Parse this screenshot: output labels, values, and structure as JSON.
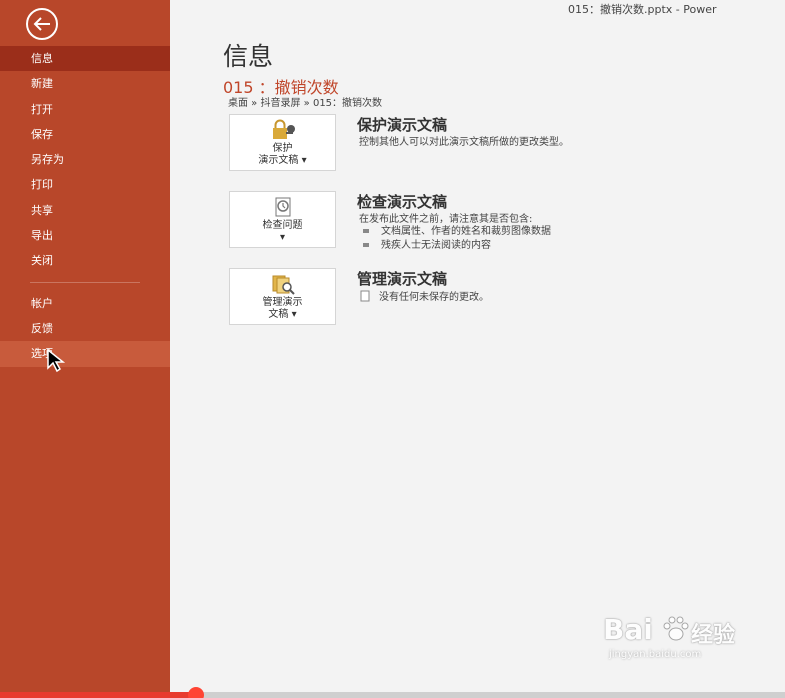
{
  "window": {
    "title": "015：撤销次数.pptx  -  Power"
  },
  "sidebar": {
    "back_icon": "back-arrow-icon",
    "items": [
      {
        "label": "信息"
      },
      {
        "label": "新建"
      },
      {
        "label": "打开"
      },
      {
        "label": "保存"
      },
      {
        "label": "另存为"
      },
      {
        "label": "打印"
      },
      {
        "label": "共享"
      },
      {
        "label": "导出"
      },
      {
        "label": "关闭"
      }
    ],
    "bottom_items": [
      {
        "label": "帐户"
      },
      {
        "label": "反馈"
      },
      {
        "label": "选项"
      }
    ],
    "active_index": 0,
    "hover_label": "选项",
    "colors": {
      "background": "#b8472a",
      "active": "#9b2e1a",
      "hover": "#c85b3c"
    }
  },
  "main": {
    "heading": "信息",
    "file_title": "015 ：撤销次数",
    "breadcrumb": "桌面 » 抖音录屏 » 015：撤销次数",
    "accent_color": "#c0462a",
    "sections": [
      {
        "button_label": "保护\n演示文稿 ▾",
        "icon": "lock-key-icon",
        "title": "保护演示文稿",
        "description": "控制其他人可以对此演示文稿所做的更改类型。"
      },
      {
        "button_label": "检查问题\n▾",
        "icon": "inspect-document-icon",
        "title": "检查演示文稿",
        "description": "在发布此文件之前，请注意其是否包含:",
        "bullets": [
          "文档属性、作者的姓名和裁剪图像数据",
          "残疾人士无法阅读的内容"
        ]
      },
      {
        "button_label": "管理演示\n文稿 ▾",
        "icon": "manage-versions-icon",
        "title": "管理演示文稿",
        "status": "没有任何未保存的更改。"
      }
    ]
  },
  "progress": {
    "value": 0.25,
    "color": "#e83b2e"
  },
  "watermark": {
    "brand": "Bai",
    "brand_cn": "经验",
    "url": "jingyan.baidu.com"
  }
}
